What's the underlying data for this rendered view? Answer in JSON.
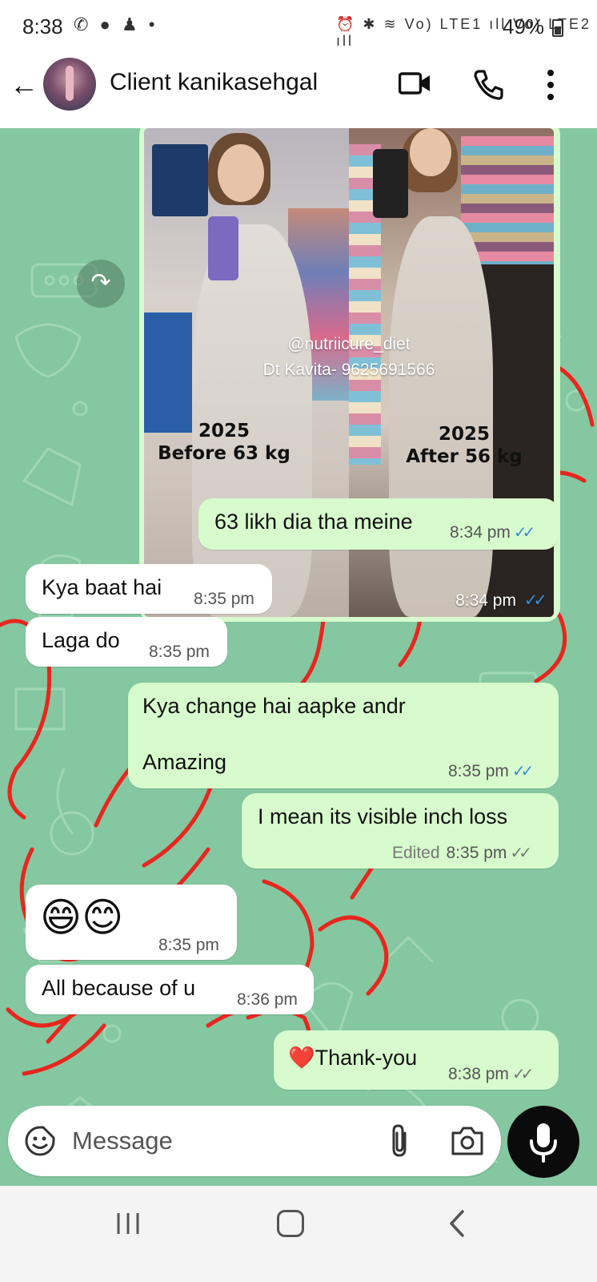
{
  "status_bar": {
    "time": "8:38",
    "left_icons": [
      "whatsapp-call-icon",
      "chat-icon",
      "snapchat-icon",
      "dot-icon"
    ],
    "right_icons": [
      "alarm-icon",
      "bluetooth-icon",
      "wifi-icon",
      "volte-lte1-signal-icon",
      "volte-lte2-signal-icon"
    ],
    "left_icons_text": "✆ ● ♟ •",
    "right_icons_text": "⏰ ✱ ≋ Vo) LTE1 ıll Vo) LTE2 ıll",
    "battery": "49%"
  },
  "header": {
    "back_glyph": "←",
    "contact_name": "Client kanikasehgal"
  },
  "image_message": {
    "watermark_handle": "@nutriicure_diet",
    "watermark_contact": "Dt Kavita- 9625691566",
    "before_caption_year": "2025",
    "before_caption_label": "Before 63 kg",
    "after_caption_year": "2025",
    "after_caption_label": "After 56 kg",
    "time": "8:34 pm",
    "ticks": "✓✓",
    "forward_glyph": "↷"
  },
  "messages": [
    {
      "direction": "out",
      "text": "63 likh dia tha meine",
      "time": "8:34 pm",
      "ticks": "✓✓",
      "read": true
    },
    {
      "direction": "in",
      "text": "Kya baat hai",
      "time": "8:35 pm"
    },
    {
      "direction": "in",
      "text": "Laga do",
      "time": "8:35 pm"
    },
    {
      "direction": "out",
      "text_line1": "Kya change hai aapke andr",
      "text_line2": "Amazing",
      "time": "8:35 pm",
      "ticks": "✓✓",
      "read": true
    },
    {
      "direction": "out",
      "text": "I mean its visible inch loss",
      "edited_label": "Edited",
      "time": "8:35 pm",
      "ticks": "✓✓",
      "read": false
    },
    {
      "direction": "in",
      "text": "😄😊",
      "time": "8:35 pm"
    },
    {
      "direction": "in",
      "text": "All because of u",
      "time": "8:36 pm"
    },
    {
      "direction": "out",
      "text": "❤️Thank-you",
      "time": "8:38 pm",
      "ticks": "✓✓",
      "read": false
    }
  ],
  "composer": {
    "placeholder": "Message",
    "emoji_icon": "sticker-emoji-icon",
    "attach_icon": "paperclip-icon",
    "camera_icon": "camera-icon",
    "mic_icon": "microphone-icon"
  },
  "colors": {
    "chat_bg": "#84c7a0",
    "outgoing_bubble": "#d7fbcc",
    "incoming_bubble": "#ffffff",
    "read_ticks": "#3b8fd6",
    "sent_ticks": "#777777",
    "watermark_red": "#e8261f"
  }
}
